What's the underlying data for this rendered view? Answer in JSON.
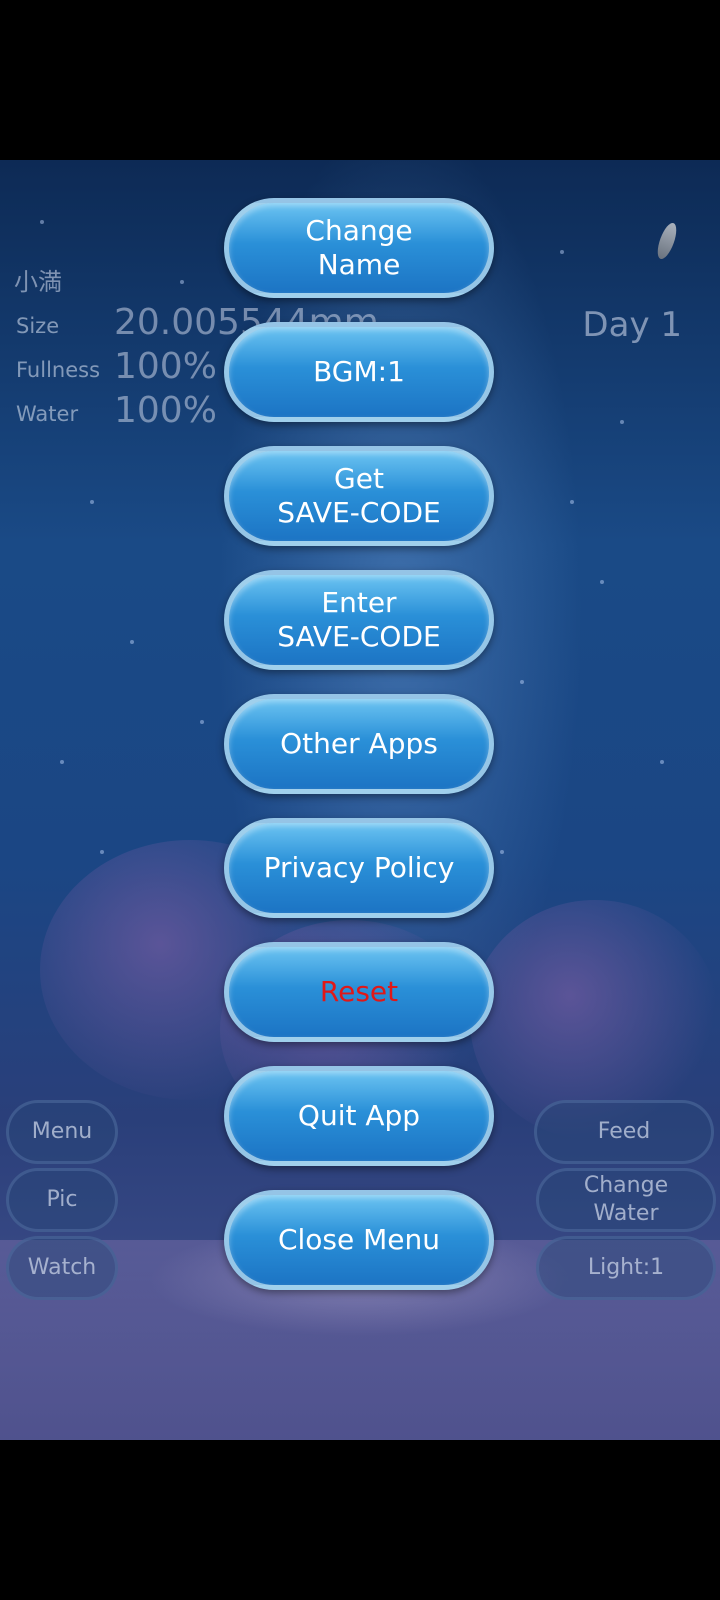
{
  "fish": {
    "name": "小満",
    "size_label": "Size",
    "size_value": "20.005544mm",
    "fullness_label": "Fullness",
    "fullness_value": "100%",
    "water_label": "Water",
    "water_value": "100%",
    "day": "Day 1"
  },
  "menu": {
    "change_name": "Change\nName",
    "bgm": "BGM:1",
    "get_save_code": "Get\nSAVE-CODE",
    "enter_save_code": "Enter\nSAVE-CODE",
    "other_apps": "Other Apps",
    "privacy_policy": "Privacy Policy",
    "reset": "Reset",
    "quit_app": "Quit App",
    "close_menu": "Close Menu"
  },
  "left_controls": {
    "menu": "Menu",
    "pic": "Pic",
    "watch": "Watch"
  },
  "right_controls": {
    "feed": "Feed",
    "change_water": "Change\nWater",
    "light": "Light:1"
  },
  "colors": {
    "button_fill": "#2a90d8",
    "reset_text": "#e01818"
  }
}
